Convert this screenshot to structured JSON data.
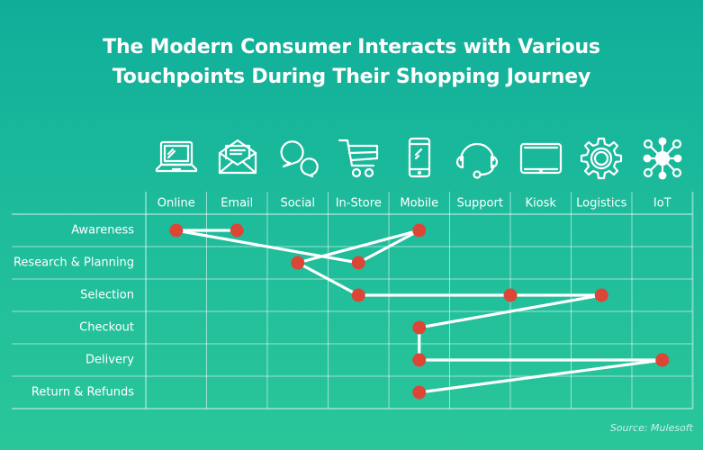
{
  "chart_data": {
    "type": "scatter",
    "title": "The Modern Consumer Interacts with Various Touchpoints During Their Shopping Journey",
    "title_lines": [
      "The Modern Consumer Interacts with Various",
      "Touchpoints During Their Shopping Journey"
    ],
    "columns": [
      {
        "label": "Online",
        "icon": "laptop-icon"
      },
      {
        "label": "Email",
        "icon": "envelope-icon"
      },
      {
        "label": "Social",
        "icon": "chat-bubbles-icon"
      },
      {
        "label": "In-Store",
        "icon": "shopping-cart-icon"
      },
      {
        "label": "Mobile",
        "icon": "smartphone-icon"
      },
      {
        "label": "Support",
        "icon": "headset-icon"
      },
      {
        "label": "Kiosk",
        "icon": "tablet-icon"
      },
      {
        "label": "Logistics",
        "icon": "gear-icon"
      },
      {
        "label": "IoT",
        "icon": "network-hub-icon"
      }
    ],
    "rows": [
      "Awareness",
      "Research & Planning",
      "Selection",
      "Checkout",
      "Delivery",
      "Return & Refunds"
    ],
    "points": [
      {
        "row": "Awareness",
        "col": "Email",
        "x_offset": 0.5
      },
      {
        "row": "Awareness",
        "col": "Online",
        "x_offset": 0.5
      },
      {
        "row": "Research & Planning",
        "col": "In-Store",
        "x_offset": 0.5
      },
      {
        "row": "Awareness",
        "col": "Mobile",
        "x_offset": 0.5
      },
      {
        "row": "Research & Planning",
        "col": "Social",
        "x_offset": 0.5
      },
      {
        "row": "Selection",
        "col": "In-Store",
        "x_offset": 0.5
      },
      {
        "row": "Selection",
        "col": "Kiosk",
        "x_offset": 0.0
      },
      {
        "row": "Selection",
        "col": "Logistics",
        "x_offset": 0.5
      },
      {
        "row": "Checkout",
        "col": "Mobile",
        "x_offset": 0.5
      },
      {
        "row": "Delivery",
        "col": "Mobile",
        "x_offset": 0.5
      },
      {
        "row": "Delivery",
        "col": "IoT",
        "x_offset": 0.5
      },
      {
        "row": "Return & Refunds",
        "col": "Mobile",
        "x_offset": 0.5
      }
    ],
    "path_order": "points connected sequentially in listed order",
    "colors": {
      "point": "#dc4637",
      "line": "#ffffff",
      "grid": "#ffffff"
    },
    "source": "Source: Mulesoft"
  }
}
